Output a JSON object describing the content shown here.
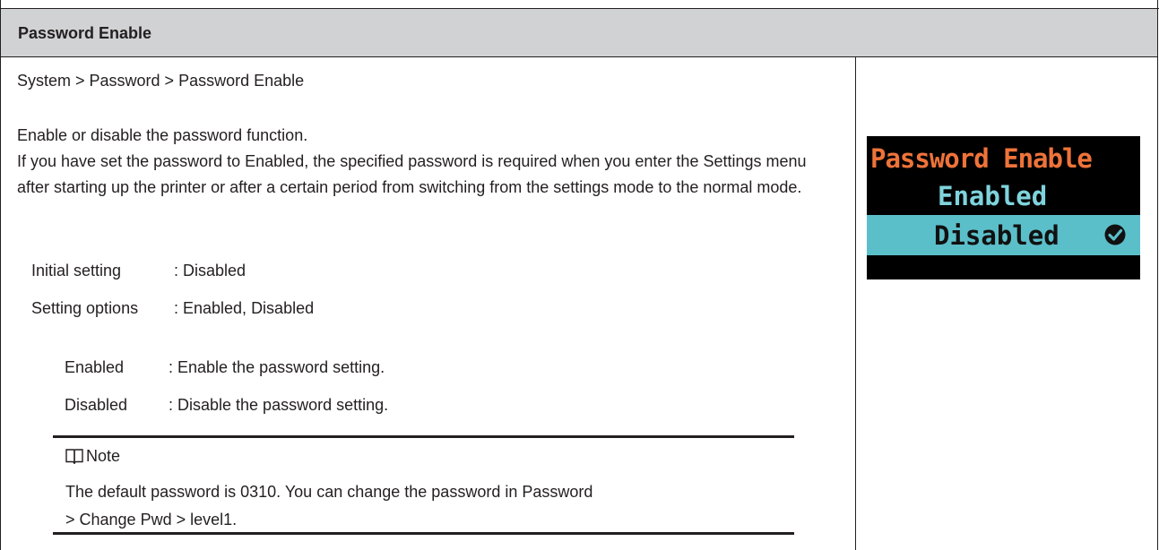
{
  "header": {
    "title": "Password Enable"
  },
  "breadcrumb": "System > Password > Password Enable",
  "description": {
    "line1": "Enable or disable the password function.",
    "line2": "If you have set the password to Enabled, the specified password is required when you enter the Settings menu after starting up the printer or after a certain period from switching from the settings mode to the normal mode."
  },
  "settings": {
    "initial_label": "Initial setting",
    "initial_value": ": Disabled",
    "options_label": "Setting options",
    "options_value": ": Enabled, Disabled"
  },
  "option_details": [
    {
      "label": "Enabled",
      "desc": ": Enable the password setting."
    },
    {
      "label": "Disabled",
      "desc": ": Disable the password setting."
    }
  ],
  "note": {
    "icon": "book-icon",
    "title": "Note",
    "text_line1": "The default password is 0310. You can change the password in Password",
    "text_line2": "> Change Pwd > level1."
  },
  "lcd": {
    "title": "Password Enable",
    "option1": "Enabled",
    "option2": "Disabled",
    "selected": "Disabled",
    "colors": {
      "background": "#000000",
      "title": "#ef7339",
      "option": "#7fd3dc",
      "highlight": "#5bbfc9"
    }
  }
}
